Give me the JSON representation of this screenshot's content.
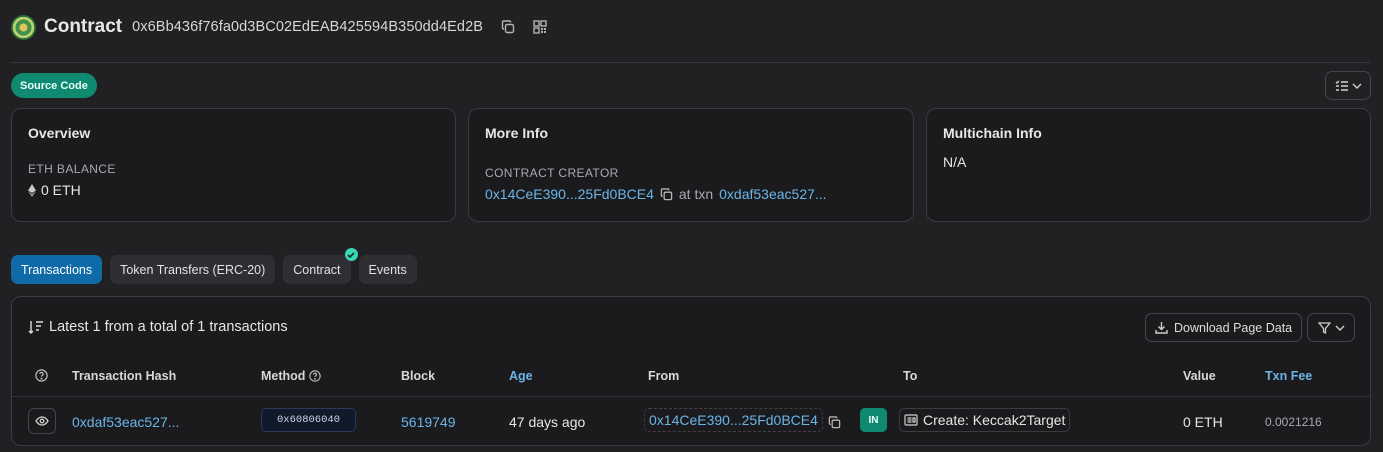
{
  "header": {
    "title": "Contract",
    "address": "0x6Bb436f76fa0d3BC02EdEAB425594B350dd4Ed2B"
  },
  "source_code_badge": "Source Code",
  "overview": {
    "title": "Overview",
    "balance_label": "ETH BALANCE",
    "balance_value": "0 ETH"
  },
  "more_info": {
    "title": "More Info",
    "creator_label": "CONTRACT CREATOR",
    "creator_address": "0x14CeE390...25Fd0BCE4",
    "at_txn_text": "at txn",
    "txn_hash": "0xdaf53eac527..."
  },
  "multichain": {
    "title": "Multichain Info",
    "value": "N/A"
  },
  "tabs": [
    {
      "label": "Transactions"
    },
    {
      "label": "Token Transfers (ERC-20)"
    },
    {
      "label": "Contract"
    },
    {
      "label": "Events"
    }
  ],
  "transactions": {
    "summary": "Latest 1 from a total of 1 transactions",
    "download_label": "Download Page Data",
    "columns": {
      "hash": "Transaction Hash",
      "method": "Method",
      "block": "Block",
      "age": "Age",
      "from": "From",
      "to": "To",
      "value": "Value",
      "fee": "Txn Fee"
    },
    "rows": [
      {
        "hash": "0xdaf53eac527...",
        "method": "0x60806040",
        "block": "5619749",
        "age": "47 days ago",
        "from": "0x14CeE390...25Fd0BCE4",
        "direction": "IN",
        "to": "Create: Keccak2Target",
        "value": "0 ETH",
        "fee": "0.0021216"
      }
    ]
  }
}
